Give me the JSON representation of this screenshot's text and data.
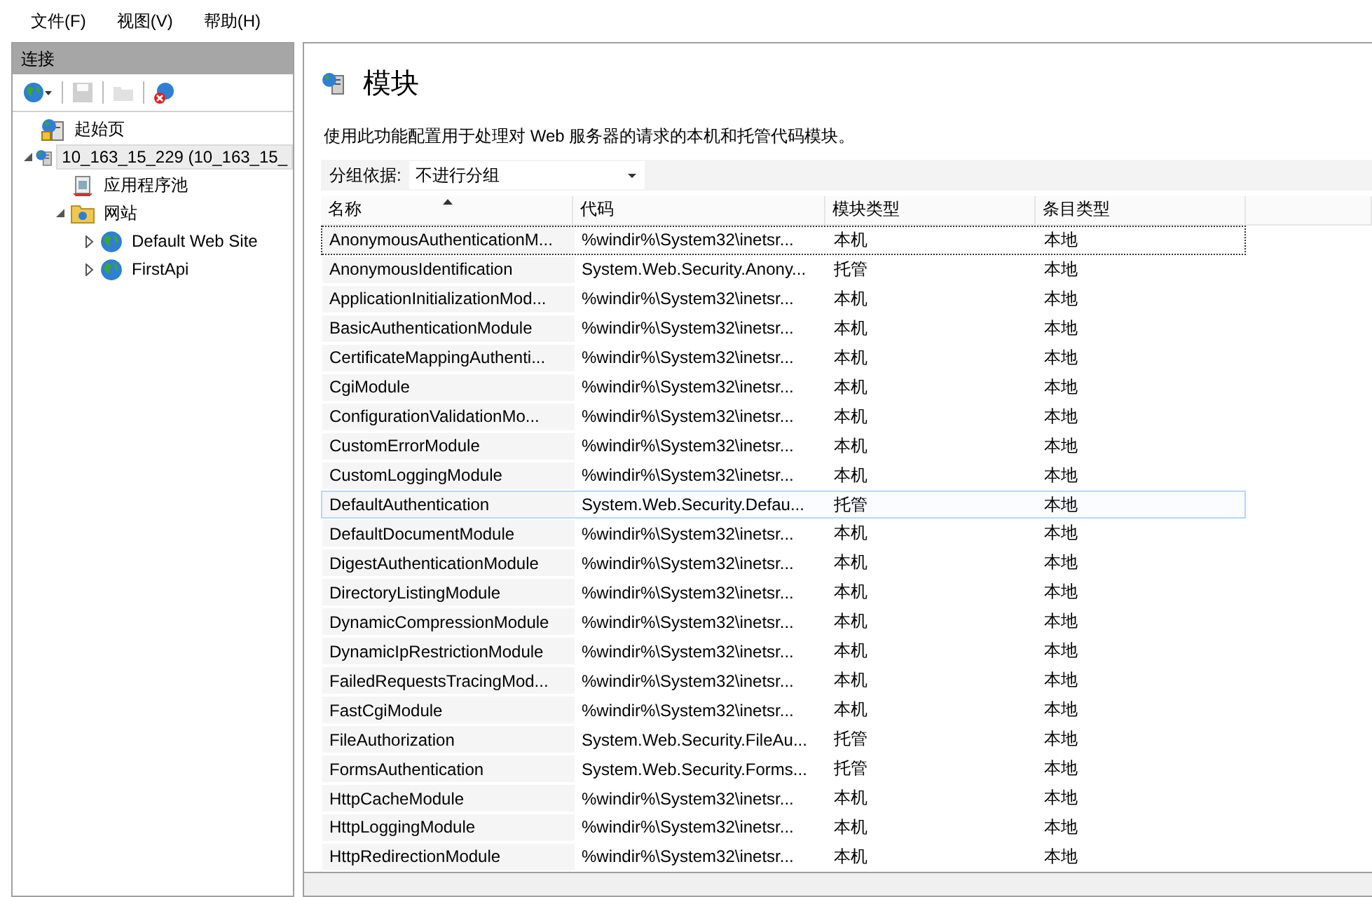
{
  "menu": [
    "文件(F)",
    "视图(V)",
    "帮助(H)"
  ],
  "connections": {
    "title": "连接",
    "toolbar": [
      {
        "kind": "connect",
        "disabled": false
      },
      {
        "kind": "save",
        "disabled": true
      },
      {
        "kind": "up",
        "disabled": true
      },
      {
        "kind": "disconnect",
        "disabled": false
      }
    ],
    "tree": [
      {
        "label": "起始页",
        "kind": "start",
        "selected": false
      },
      {
        "label": "10_163_15_229 (10_163_15_",
        "kind": "server",
        "selected": true,
        "expanded": true,
        "children": [
          {
            "label": "应用程序池",
            "kind": "pool",
            "selected": false
          },
          {
            "label": "网站",
            "kind": "folder",
            "selected": false,
            "expanded": true,
            "children": [
              {
                "label": "Default Web Site",
                "kind": "site",
                "selected": false,
                "expanded": false
              },
              {
                "label": "FirstApi",
                "kind": "site",
                "selected": false,
                "expanded": false
              }
            ]
          }
        ]
      }
    ]
  },
  "page": {
    "title": "模块",
    "description": "使用此功能配置用于处理对 Web 服务器的请求的本机和托管代码模块。",
    "group_by": {
      "label": "分组依据:",
      "value": "不进行分组"
    }
  },
  "table": {
    "columns": [
      {
        "label": "名称",
        "sorted": true
      },
      {
        "label": "代码",
        "sorted": false
      },
      {
        "label": "模块类型",
        "sorted": false
      },
      {
        "label": "条目类型",
        "sorted": false
      }
    ],
    "rows": [
      {
        "cells": [
          "AnonymousAuthenticationM...",
          "%windir%\\System32\\inetsr...",
          "本机",
          "本地"
        ],
        "focused": true,
        "hovered": false
      },
      {
        "cells": [
          "AnonymousIdentification",
          "System.Web.Security.Anony...",
          "托管",
          "本地"
        ],
        "focused": false,
        "hovered": false
      },
      {
        "cells": [
          "ApplicationInitializationMod...",
          "%windir%\\System32\\inetsr...",
          "本机",
          "本地"
        ],
        "focused": false,
        "hovered": false
      },
      {
        "cells": [
          "BasicAuthenticationModule",
          "%windir%\\System32\\inetsr...",
          "本机",
          "本地"
        ],
        "focused": false,
        "hovered": false
      },
      {
        "cells": [
          "CertificateMappingAuthenti...",
          "%windir%\\System32\\inetsr...",
          "本机",
          "本地"
        ],
        "focused": false,
        "hovered": false
      },
      {
        "cells": [
          "CgiModule",
          "%windir%\\System32\\inetsr...",
          "本机",
          "本地"
        ],
        "focused": false,
        "hovered": false
      },
      {
        "cells": [
          "ConfigurationValidationMo...",
          "%windir%\\System32\\inetsr...",
          "本机",
          "本地"
        ],
        "focused": false,
        "hovered": false
      },
      {
        "cells": [
          "CustomErrorModule",
          "%windir%\\System32\\inetsr...",
          "本机",
          "本地"
        ],
        "focused": false,
        "hovered": false
      },
      {
        "cells": [
          "CustomLoggingModule",
          "%windir%\\System32\\inetsr...",
          "本机",
          "本地"
        ],
        "focused": false,
        "hovered": false
      },
      {
        "cells": [
          "DefaultAuthentication",
          "System.Web.Security.Defau...",
          "托管",
          "本地"
        ],
        "focused": false,
        "hovered": true
      },
      {
        "cells": [
          "DefaultDocumentModule",
          "%windir%\\System32\\inetsr...",
          "本机",
          "本地"
        ],
        "focused": false,
        "hovered": false
      },
      {
        "cells": [
          "DigestAuthenticationModule",
          "%windir%\\System32\\inetsr...",
          "本机",
          "本地"
        ],
        "focused": false,
        "hovered": false
      },
      {
        "cells": [
          "DirectoryListingModule",
          "%windir%\\System32\\inetsr...",
          "本机",
          "本地"
        ],
        "focused": false,
        "hovered": false
      },
      {
        "cells": [
          "DynamicCompressionModule",
          "%windir%\\System32\\inetsr...",
          "本机",
          "本地"
        ],
        "focused": false,
        "hovered": false
      },
      {
        "cells": [
          "DynamicIpRestrictionModule",
          "%windir%\\System32\\inetsr...",
          "本机",
          "本地"
        ],
        "focused": false,
        "hovered": false
      },
      {
        "cells": [
          "FailedRequestsTracingMod...",
          "%windir%\\System32\\inetsr...",
          "本机",
          "本地"
        ],
        "focused": false,
        "hovered": false
      },
      {
        "cells": [
          "FastCgiModule",
          "%windir%\\System32\\inetsr...",
          "本机",
          "本地"
        ],
        "focused": false,
        "hovered": false
      },
      {
        "cells": [
          "FileAuthorization",
          "System.Web.Security.FileAu...",
          "托管",
          "本地"
        ],
        "focused": false,
        "hovered": false
      },
      {
        "cells": [
          "FormsAuthentication",
          "System.Web.Security.Forms...",
          "托管",
          "本地"
        ],
        "focused": false,
        "hovered": false
      },
      {
        "cells": [
          "HttpCacheModule",
          "%windir%\\System32\\inetsr...",
          "本机",
          "本地"
        ],
        "focused": false,
        "hovered": false
      },
      {
        "cells": [
          "HttpLoggingModule",
          "%windir%\\System32\\inetsr...",
          "本机",
          "本地"
        ],
        "focused": false,
        "hovered": false
      },
      {
        "cells": [
          "HttpRedirectionModule",
          "%windir%\\System32\\inetsr...",
          "本机",
          "本地"
        ],
        "focused": false,
        "hovered": false
      }
    ]
  }
}
